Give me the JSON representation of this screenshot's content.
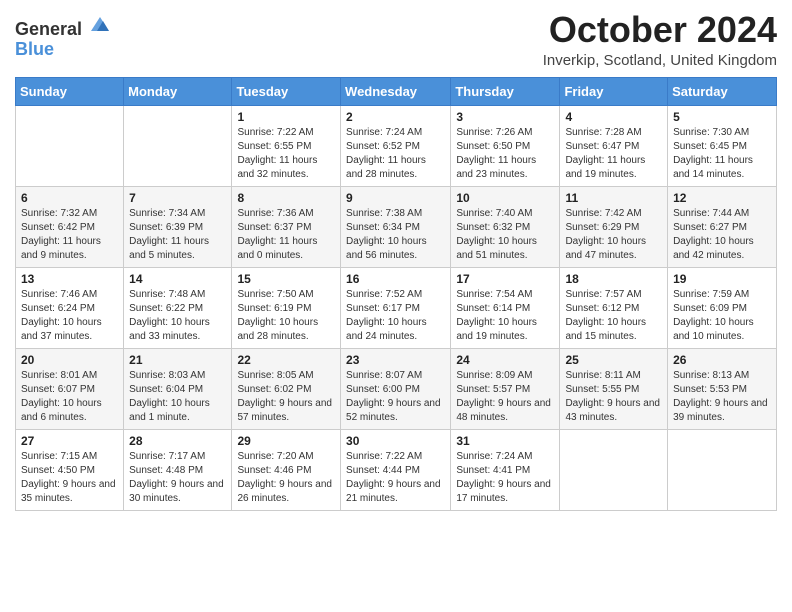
{
  "header": {
    "logo": {
      "line1": "General",
      "line2": "Blue"
    },
    "title": "October 2024",
    "location": "Inverkip, Scotland, United Kingdom"
  },
  "calendar": {
    "weekdays": [
      "Sunday",
      "Monday",
      "Tuesday",
      "Wednesday",
      "Thursday",
      "Friday",
      "Saturday"
    ],
    "weeks": [
      [
        {
          "day": "",
          "sunrise": "",
          "sunset": "",
          "daylight": ""
        },
        {
          "day": "",
          "sunrise": "",
          "sunset": "",
          "daylight": ""
        },
        {
          "day": "1",
          "sunrise": "Sunrise: 7:22 AM",
          "sunset": "Sunset: 6:55 PM",
          "daylight": "Daylight: 11 hours and 32 minutes."
        },
        {
          "day": "2",
          "sunrise": "Sunrise: 7:24 AM",
          "sunset": "Sunset: 6:52 PM",
          "daylight": "Daylight: 11 hours and 28 minutes."
        },
        {
          "day": "3",
          "sunrise": "Sunrise: 7:26 AM",
          "sunset": "Sunset: 6:50 PM",
          "daylight": "Daylight: 11 hours and 23 minutes."
        },
        {
          "day": "4",
          "sunrise": "Sunrise: 7:28 AM",
          "sunset": "Sunset: 6:47 PM",
          "daylight": "Daylight: 11 hours and 19 minutes."
        },
        {
          "day": "5",
          "sunrise": "Sunrise: 7:30 AM",
          "sunset": "Sunset: 6:45 PM",
          "daylight": "Daylight: 11 hours and 14 minutes."
        }
      ],
      [
        {
          "day": "6",
          "sunrise": "Sunrise: 7:32 AM",
          "sunset": "Sunset: 6:42 PM",
          "daylight": "Daylight: 11 hours and 9 minutes."
        },
        {
          "day": "7",
          "sunrise": "Sunrise: 7:34 AM",
          "sunset": "Sunset: 6:39 PM",
          "daylight": "Daylight: 11 hours and 5 minutes."
        },
        {
          "day": "8",
          "sunrise": "Sunrise: 7:36 AM",
          "sunset": "Sunset: 6:37 PM",
          "daylight": "Daylight: 11 hours and 0 minutes."
        },
        {
          "day": "9",
          "sunrise": "Sunrise: 7:38 AM",
          "sunset": "Sunset: 6:34 PM",
          "daylight": "Daylight: 10 hours and 56 minutes."
        },
        {
          "day": "10",
          "sunrise": "Sunrise: 7:40 AM",
          "sunset": "Sunset: 6:32 PM",
          "daylight": "Daylight: 10 hours and 51 minutes."
        },
        {
          "day": "11",
          "sunrise": "Sunrise: 7:42 AM",
          "sunset": "Sunset: 6:29 PM",
          "daylight": "Daylight: 10 hours and 47 minutes."
        },
        {
          "day": "12",
          "sunrise": "Sunrise: 7:44 AM",
          "sunset": "Sunset: 6:27 PM",
          "daylight": "Daylight: 10 hours and 42 minutes."
        }
      ],
      [
        {
          "day": "13",
          "sunrise": "Sunrise: 7:46 AM",
          "sunset": "Sunset: 6:24 PM",
          "daylight": "Daylight: 10 hours and 37 minutes."
        },
        {
          "day": "14",
          "sunrise": "Sunrise: 7:48 AM",
          "sunset": "Sunset: 6:22 PM",
          "daylight": "Daylight: 10 hours and 33 minutes."
        },
        {
          "day": "15",
          "sunrise": "Sunrise: 7:50 AM",
          "sunset": "Sunset: 6:19 PM",
          "daylight": "Daylight: 10 hours and 28 minutes."
        },
        {
          "day": "16",
          "sunrise": "Sunrise: 7:52 AM",
          "sunset": "Sunset: 6:17 PM",
          "daylight": "Daylight: 10 hours and 24 minutes."
        },
        {
          "day": "17",
          "sunrise": "Sunrise: 7:54 AM",
          "sunset": "Sunset: 6:14 PM",
          "daylight": "Daylight: 10 hours and 19 minutes."
        },
        {
          "day": "18",
          "sunrise": "Sunrise: 7:57 AM",
          "sunset": "Sunset: 6:12 PM",
          "daylight": "Daylight: 10 hours and 15 minutes."
        },
        {
          "day": "19",
          "sunrise": "Sunrise: 7:59 AM",
          "sunset": "Sunset: 6:09 PM",
          "daylight": "Daylight: 10 hours and 10 minutes."
        }
      ],
      [
        {
          "day": "20",
          "sunrise": "Sunrise: 8:01 AM",
          "sunset": "Sunset: 6:07 PM",
          "daylight": "Daylight: 10 hours and 6 minutes."
        },
        {
          "day": "21",
          "sunrise": "Sunrise: 8:03 AM",
          "sunset": "Sunset: 6:04 PM",
          "daylight": "Daylight: 10 hours and 1 minute."
        },
        {
          "day": "22",
          "sunrise": "Sunrise: 8:05 AM",
          "sunset": "Sunset: 6:02 PM",
          "daylight": "Daylight: 9 hours and 57 minutes."
        },
        {
          "day": "23",
          "sunrise": "Sunrise: 8:07 AM",
          "sunset": "Sunset: 6:00 PM",
          "daylight": "Daylight: 9 hours and 52 minutes."
        },
        {
          "day": "24",
          "sunrise": "Sunrise: 8:09 AM",
          "sunset": "Sunset: 5:57 PM",
          "daylight": "Daylight: 9 hours and 48 minutes."
        },
        {
          "day": "25",
          "sunrise": "Sunrise: 8:11 AM",
          "sunset": "Sunset: 5:55 PM",
          "daylight": "Daylight: 9 hours and 43 minutes."
        },
        {
          "day": "26",
          "sunrise": "Sunrise: 8:13 AM",
          "sunset": "Sunset: 5:53 PM",
          "daylight": "Daylight: 9 hours and 39 minutes."
        }
      ],
      [
        {
          "day": "27",
          "sunrise": "Sunrise: 7:15 AM",
          "sunset": "Sunset: 4:50 PM",
          "daylight": "Daylight: 9 hours and 35 minutes."
        },
        {
          "day": "28",
          "sunrise": "Sunrise: 7:17 AM",
          "sunset": "Sunset: 4:48 PM",
          "daylight": "Daylight: 9 hours and 30 minutes."
        },
        {
          "day": "29",
          "sunrise": "Sunrise: 7:20 AM",
          "sunset": "Sunset: 4:46 PM",
          "daylight": "Daylight: 9 hours and 26 minutes."
        },
        {
          "day": "30",
          "sunrise": "Sunrise: 7:22 AM",
          "sunset": "Sunset: 4:44 PM",
          "daylight": "Daylight: 9 hours and 21 minutes."
        },
        {
          "day": "31",
          "sunrise": "Sunrise: 7:24 AM",
          "sunset": "Sunset: 4:41 PM",
          "daylight": "Daylight: 9 hours and 17 minutes."
        },
        {
          "day": "",
          "sunrise": "",
          "sunset": "",
          "daylight": ""
        },
        {
          "day": "",
          "sunrise": "",
          "sunset": "",
          "daylight": ""
        }
      ]
    ]
  }
}
